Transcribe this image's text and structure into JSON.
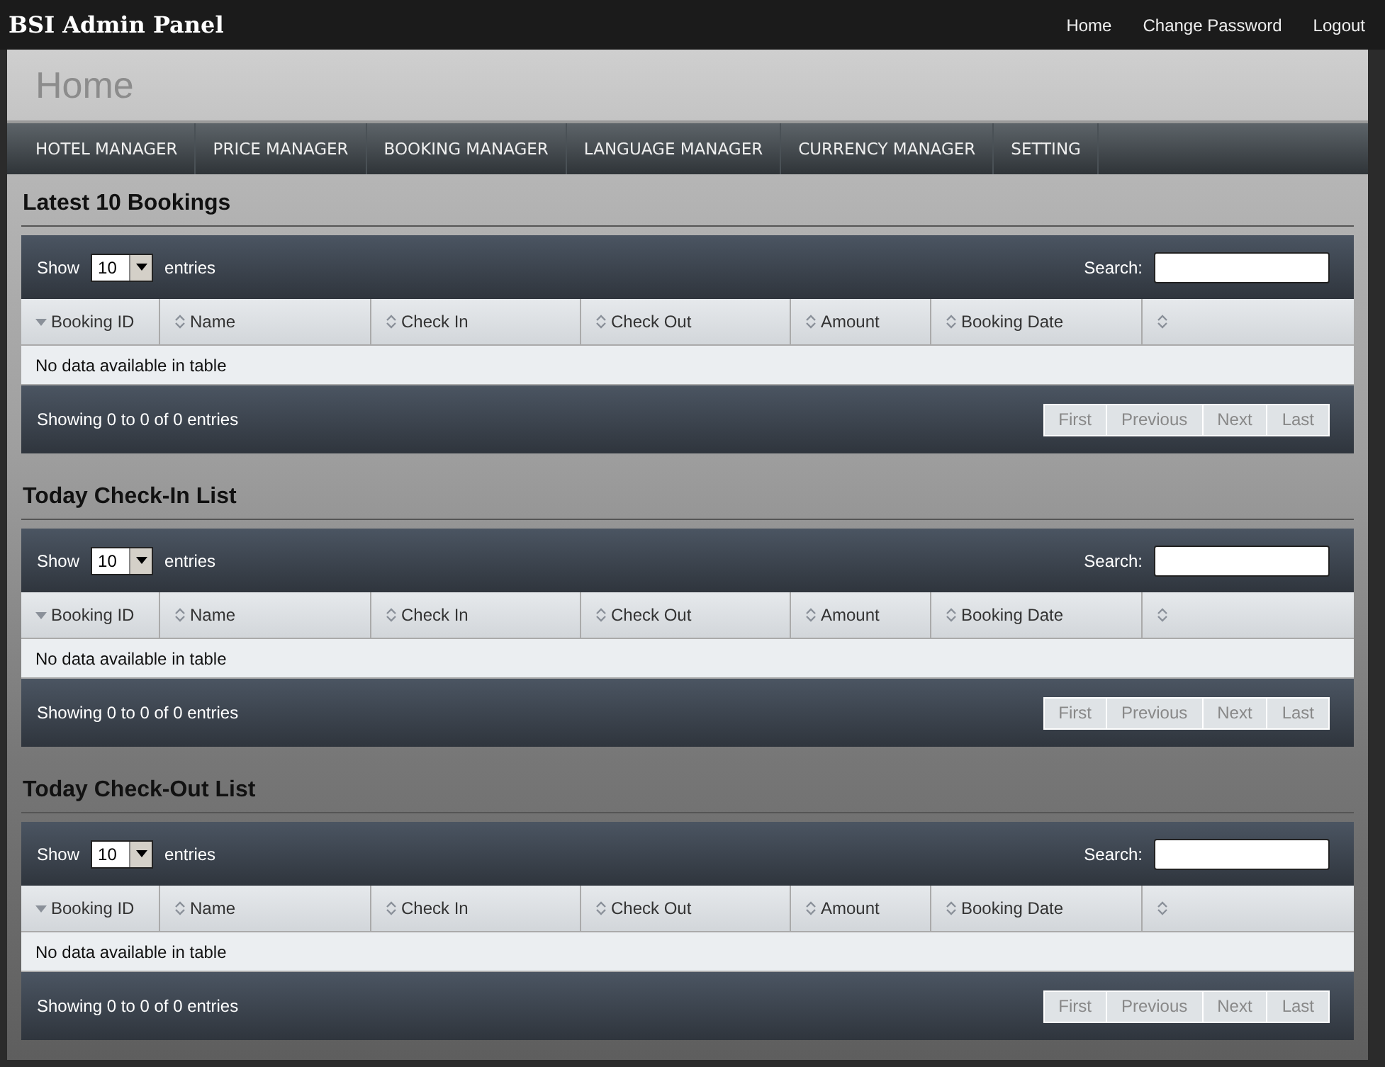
{
  "app_title": "BSI Admin Panel",
  "top_links": [
    "Home",
    "Change Password",
    "Logout"
  ],
  "page_title": "Home",
  "nav": [
    "HOTEL MANAGER",
    "PRICE MANAGER",
    "BOOKING MANAGER",
    "LANGUAGE MANAGER",
    "CURRENCY MANAGER",
    "SETTING"
  ],
  "sections": [
    {
      "title": "Latest 10 Bookings",
      "length_label": "Show",
      "length_value": "10",
      "length_suffix": "entries",
      "search_label": "Search:",
      "columns": [
        {
          "label": "Booking ID",
          "sorted": true
        },
        {
          "label": "Name",
          "sorted": false
        },
        {
          "label": "Check In",
          "sorted": false
        },
        {
          "label": "Check Out",
          "sorted": false
        },
        {
          "label": "Amount",
          "sorted": false
        },
        {
          "label": "Booking Date",
          "sorted": false
        },
        {
          "sorted": false
        }
      ],
      "empty_message": "No data available in table",
      "info": "Showing 0 to 0 of 0 entries",
      "pager": [
        {
          "label": "First",
          "disabled": true
        },
        {
          "label": "Previous",
          "disabled": true
        },
        {
          "label": "Next",
          "disabled": true
        },
        {
          "label": "Last",
          "disabled": true
        }
      ]
    },
    {
      "title": "Today Check-In List",
      "length_label": "Show",
      "length_value": "10",
      "length_suffix": "entries",
      "search_label": "Search:",
      "columns": [
        {
          "label": "Booking ID",
          "sorted": true
        },
        {
          "label": "Name",
          "sorted": false
        },
        {
          "label": "Check In",
          "sorted": false
        },
        {
          "label": "Check Out",
          "sorted": false
        },
        {
          "label": "Amount",
          "sorted": false
        },
        {
          "label": "Booking Date",
          "sorted": false
        },
        {
          "sorted": false
        }
      ],
      "empty_message": "No data available in table",
      "info": "Showing 0 to 0 of 0 entries",
      "pager": [
        {
          "label": "First",
          "disabled": true
        },
        {
          "label": "Previous",
          "disabled": true
        },
        {
          "label": "Next",
          "disabled": true
        },
        {
          "label": "Last",
          "disabled": true
        }
      ]
    },
    {
      "title": "Today Check-Out List",
      "length_label": "Show",
      "length_value": "10",
      "length_suffix": "entries",
      "search_label": "Search:",
      "columns": [
        {
          "label": "Booking ID",
          "sorted": true
        },
        {
          "label": "Name",
          "sorted": false
        },
        {
          "label": "Check In",
          "sorted": false
        },
        {
          "label": "Check Out",
          "sorted": false
        },
        {
          "label": "Amount",
          "sorted": false
        },
        {
          "label": "Booking Date",
          "sorted": false
        },
        {
          "sorted": false
        }
      ],
      "empty_message": "No data available in table",
      "info": "Showing 0 to 0 of 0 entries",
      "pager": [
        {
          "label": "First",
          "disabled": true
        },
        {
          "label": "Previous",
          "disabled": true
        },
        {
          "label": "Next",
          "disabled": true
        },
        {
          "label": "Last",
          "disabled": true
        }
      ]
    }
  ]
}
